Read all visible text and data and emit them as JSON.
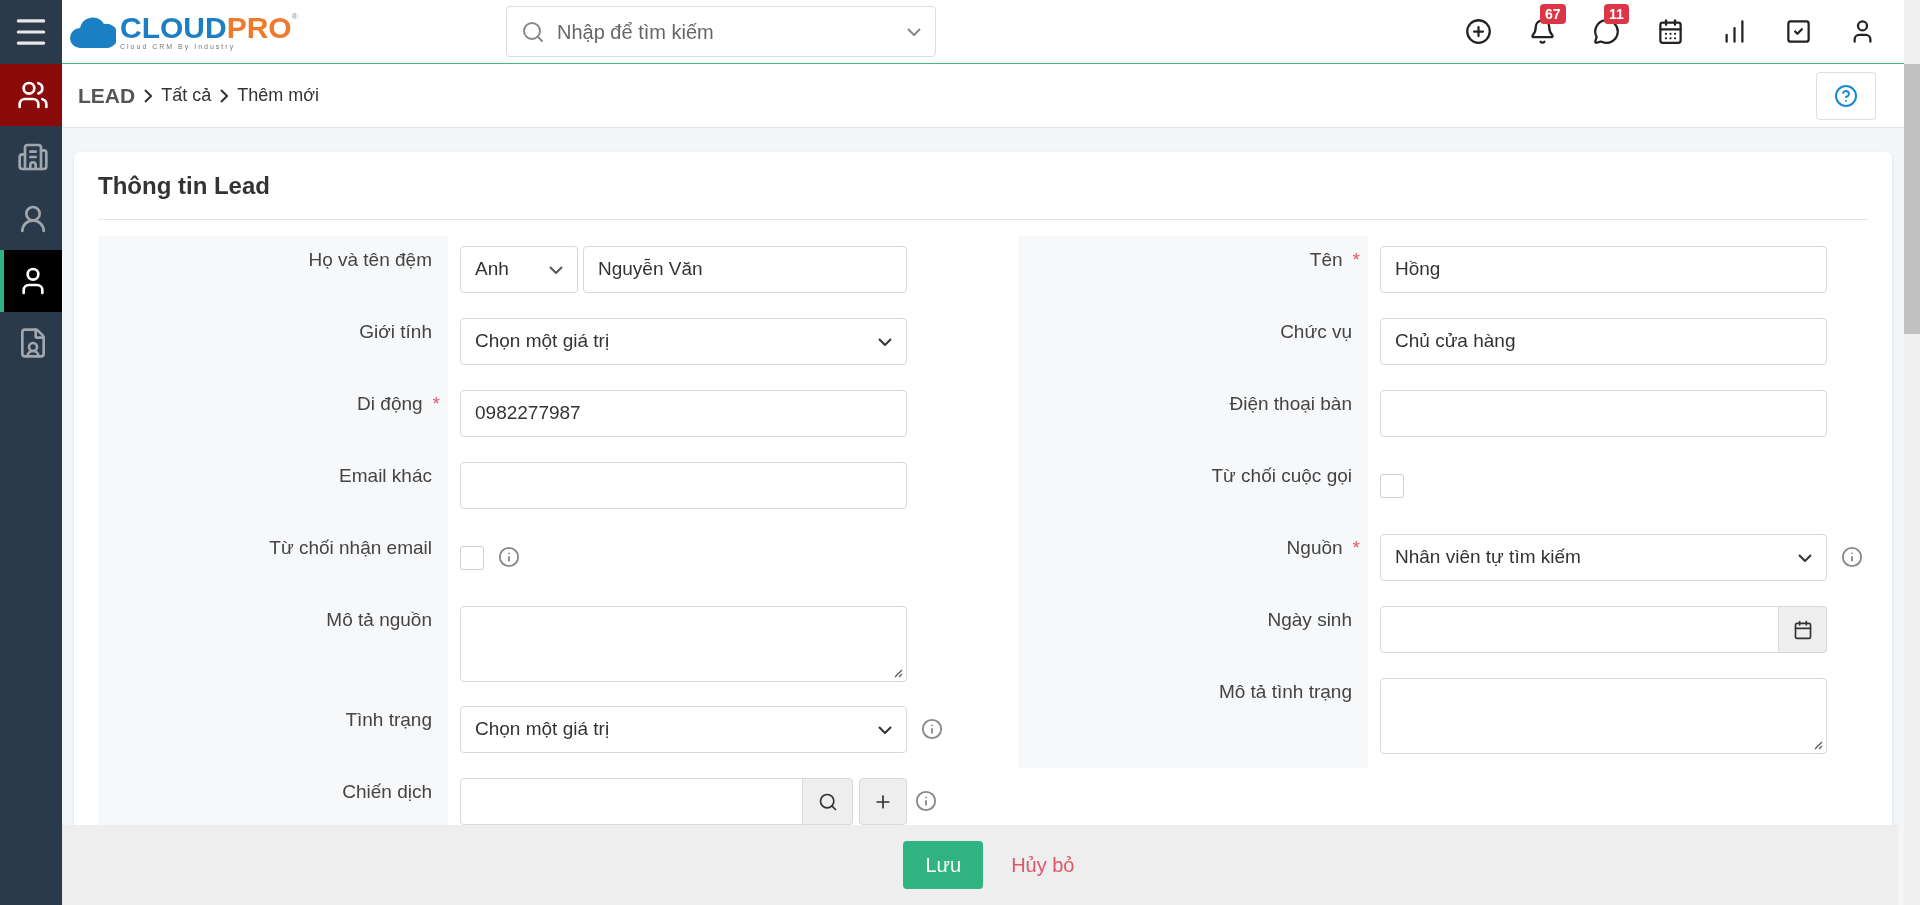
{
  "header": {
    "logo": {
      "part1": "CLOUD",
      "part2": "PRO",
      "mark": "®",
      "tagline": "Cloud CRM By Industry"
    },
    "search": {
      "placeholder": "Nhập để tìm kiếm"
    },
    "actions": [
      {
        "kind": "add"
      },
      {
        "kind": "bell",
        "badge": "67"
      },
      {
        "kind": "chat",
        "badge": "11"
      },
      {
        "kind": "calendar"
      },
      {
        "kind": "chart"
      },
      {
        "kind": "task"
      },
      {
        "kind": "user"
      }
    ]
  },
  "sidebar": {
    "items": [
      {
        "kind": "module"
      },
      {
        "kind": "building",
        "selected": false
      },
      {
        "kind": "contact",
        "selected": false
      },
      {
        "kind": "person",
        "selected": true
      },
      {
        "kind": "document",
        "selected": false
      }
    ]
  },
  "breadcrumb": [
    "LEAD",
    "Tất cả",
    "Thêm mới"
  ],
  "section": {
    "title": "Thông tin Lead"
  },
  "columns": [
    [
      {
        "kind": "salutation",
        "label": "Họ và tên đệm",
        "select": "Anh",
        "value": "Nguyễn Văn"
      },
      {
        "kind": "select",
        "label": "Giới tính",
        "value": "Chọn một giá trị"
      },
      {
        "kind": "text",
        "label": "Di động",
        "required_mark": "*",
        "value": "0982277987"
      },
      {
        "kind": "text",
        "label": "Email khác"
      },
      {
        "kind": "checkbox",
        "label": "Từ chối nhận email",
        "checked": false,
        "info": true
      },
      {
        "kind": "textarea",
        "label": "Mô tả nguồn"
      },
      {
        "kind": "select",
        "label": "Tình trạng",
        "value": "Chọn một giá trị",
        "info": true
      },
      {
        "kind": "lookup",
        "label": "Chiến dịch",
        "info": true
      }
    ],
    [
      {
        "kind": "text",
        "label": "Tên",
        "required_mark": "*",
        "value": "Hồng"
      },
      {
        "kind": "text",
        "label": "Chức vụ",
        "value": "Chủ cửa hàng"
      },
      {
        "kind": "text",
        "label": "Điện thoại bàn"
      },
      {
        "kind": "checkbox",
        "label": "Từ chối cuộc gọi",
        "checked": false
      },
      {
        "kind": "select",
        "label": "Nguồn",
        "required_mark": "*",
        "value": "Nhân viên tự tìm kiếm",
        "info": true
      },
      {
        "kind": "date",
        "label": "Ngày sinh"
      },
      {
        "kind": "textarea",
        "label": "Mô tả tình trạng"
      }
    ]
  ],
  "footer": {
    "save": "Lưu",
    "cancel": "Hủy bỏ"
  }
}
